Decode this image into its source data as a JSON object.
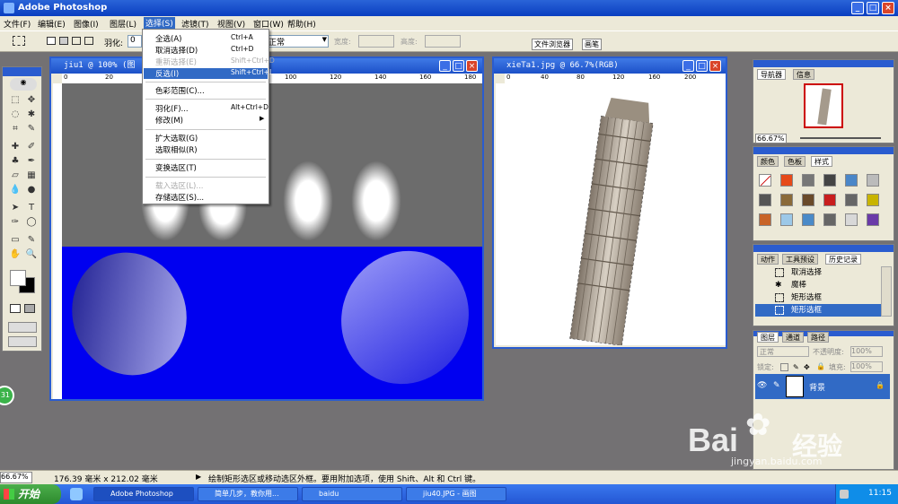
{
  "app": {
    "title": "Adobe Photoshop"
  },
  "menubar": {
    "items": [
      "文件(F)",
      "编辑(E)",
      "图像(I)",
      "图层(L)",
      "选择(S)",
      "滤镜(T)",
      "视图(V)",
      "窗口(W)",
      "帮助(H)"
    ]
  },
  "options": {
    "feather_label": "羽化:",
    "feather_value": "0",
    "style_value": "正常",
    "width_label": "宽度:",
    "height_label": "高度:"
  },
  "wells": {
    "file_browser": "文件浏览器",
    "brushes": "画笔"
  },
  "select_menu": {
    "items": [
      {
        "label": "全选(A)",
        "shortcut": "Ctrl+A",
        "enabled": true
      },
      {
        "label": "取消选择(D)",
        "shortcut": "Ctrl+D",
        "enabled": true
      },
      {
        "label": "重新选择(E)",
        "shortcut": "Shift+Ctrl+D",
        "enabled": false
      },
      {
        "label": "反选(I)",
        "shortcut": "Shift+Ctrl+I",
        "enabled": true,
        "highlighted": true
      },
      {
        "label": "色彩范围(C)...",
        "shortcut": "",
        "enabled": true
      },
      {
        "label": "羽化(F)...",
        "shortcut": "Alt+Ctrl+D",
        "enabled": true
      },
      {
        "label": "修改(M)",
        "shortcut": "",
        "enabled": true,
        "submenu": true
      },
      {
        "label": "扩大选取(G)",
        "shortcut": "",
        "enabled": true
      },
      {
        "label": "选取相似(R)",
        "shortcut": "",
        "enabled": true
      },
      {
        "label": "变换选区(T)",
        "shortcut": "",
        "enabled": true
      },
      {
        "label": "载入选区(L)...",
        "shortcut": "",
        "enabled": false
      },
      {
        "label": "存储选区(S)...",
        "shortcut": "",
        "enabled": true
      }
    ]
  },
  "doc1": {
    "title": "jiu1 @ 100% (图",
    "ruler_marks": [
      "0",
      "20",
      "40",
      "60",
      "80",
      "100",
      "120",
      "140",
      "160",
      "180"
    ],
    "canvas_top_color": "#6c6c6c",
    "canvas_bottom_color": "#0000f0"
  },
  "doc2": {
    "title": "xieTa1.jpg @ 66.7%(RGB)",
    "ruler_marks": [
      "0",
      "20",
      "40",
      "60",
      "80",
      "100",
      "120",
      "140",
      "160",
      "180",
      "200"
    ]
  },
  "navigator": {
    "tabs": [
      "导航器",
      "信息"
    ],
    "zoom": "66.67%"
  },
  "swatches": {
    "tabs": [
      "颜色",
      "色板",
      "样式"
    ]
  },
  "history": {
    "tabs": [
      "动作",
      "工具预设",
      "历史记录"
    ],
    "items": [
      "取消选择",
      "魔棒",
      "矩形选框",
      "矩形选框"
    ]
  },
  "layers": {
    "tabs": [
      "图层",
      "通道",
      "路径"
    ],
    "mode": "正常",
    "opacity_label": "不透明度:",
    "opacity": "100%",
    "lock_label": "锁定:",
    "fill_label": "填充:",
    "fill": "100%",
    "layer_name": "背景"
  },
  "status": {
    "zoom": "66.67%",
    "doc_size": "176.39 毫米 x 212.02 毫米",
    "hint": "绘制矩形选区或移动选区外框。要用附加选项，使用 Shift、Alt 和 Ctrl 键。"
  },
  "taskbar": {
    "start": "开始",
    "tasks": [
      "Adobe Photoshop",
      "简单几步，教你用...",
      "baidu",
      "jiu40.JPG - 画图"
    ],
    "clock": "11:15"
  },
  "watermark": {
    "brand": "Bai",
    "brand2": "经验",
    "url": "jingyan.baidu.com"
  },
  "badge": {
    "value": "31"
  }
}
